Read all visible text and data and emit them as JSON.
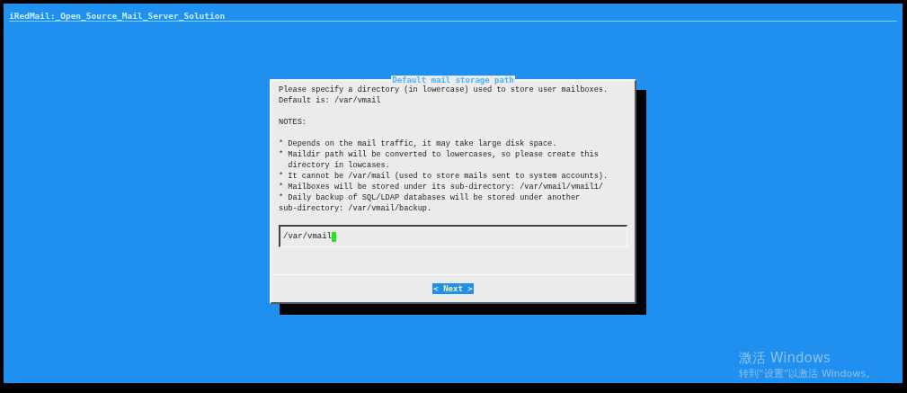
{
  "screen_title": "iRedMail:_Open_Source_Mail_Server_Solution",
  "dialog": {
    "title": "Default mail storage path",
    "paragraphs": [
      "Please specify a directory (in lowercase) used to store user mailboxes.\nDefault is: /var/vmail",
      "NOTES:",
      "* Depends on the mail traffic, it may take large disk space.\n* Maildir path will be converted to lowercases, so please create this\n  directory in lowcases.\n* It cannot be /var/mail (used to store mails sent to system accounts).\n* Mailboxes will be stored under its sub-directory: /var/vmail/vmail1/\n* Daily backup of SQL/LDAP databases will be stored under another\nsub-directory: /var/vmail/backup."
    ],
    "input": {
      "value": "/var/vmail"
    },
    "buttons": [
      {
        "label": "< Next >",
        "selected": true
      }
    ]
  },
  "activation_notice": {
    "title": "激活 Windows",
    "subtitle": "转到“设置”以激活 Windows。"
  }
}
